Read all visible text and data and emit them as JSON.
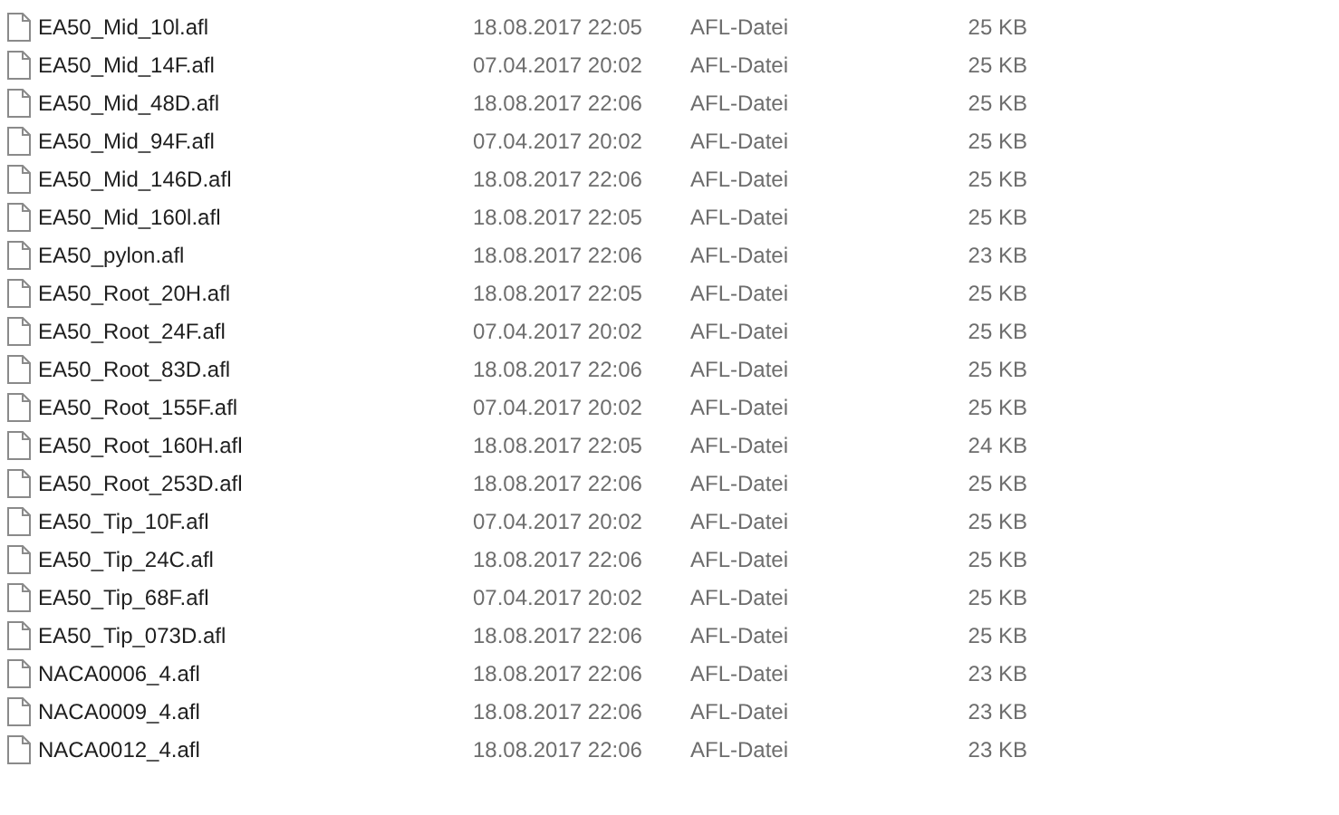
{
  "files": [
    {
      "name": "EA50_Mid_10l.afl",
      "date": "18.08.2017 22:05",
      "type": "AFL-Datei",
      "size": "25 KB"
    },
    {
      "name": "EA50_Mid_14F.afl",
      "date": "07.04.2017 20:02",
      "type": "AFL-Datei",
      "size": "25 KB"
    },
    {
      "name": "EA50_Mid_48D.afl",
      "date": "18.08.2017 22:06",
      "type": "AFL-Datei",
      "size": "25 KB"
    },
    {
      "name": "EA50_Mid_94F.afl",
      "date": "07.04.2017 20:02",
      "type": "AFL-Datei",
      "size": "25 KB"
    },
    {
      "name": "EA50_Mid_146D.afl",
      "date": "18.08.2017 22:06",
      "type": "AFL-Datei",
      "size": "25 KB"
    },
    {
      "name": "EA50_Mid_160l.afl",
      "date": "18.08.2017 22:05",
      "type": "AFL-Datei",
      "size": "25 KB"
    },
    {
      "name": "EA50_pylon.afl",
      "date": "18.08.2017 22:06",
      "type": "AFL-Datei",
      "size": "23 KB"
    },
    {
      "name": "EA50_Root_20H.afl",
      "date": "18.08.2017 22:05",
      "type": "AFL-Datei",
      "size": "25 KB"
    },
    {
      "name": "EA50_Root_24F.afl",
      "date": "07.04.2017 20:02",
      "type": "AFL-Datei",
      "size": "25 KB"
    },
    {
      "name": "EA50_Root_83D.afl",
      "date": "18.08.2017 22:06",
      "type": "AFL-Datei",
      "size": "25 KB"
    },
    {
      "name": "EA50_Root_155F.afl",
      "date": "07.04.2017 20:02",
      "type": "AFL-Datei",
      "size": "25 KB"
    },
    {
      "name": "EA50_Root_160H.afl",
      "date": "18.08.2017 22:05",
      "type": "AFL-Datei",
      "size": "24 KB"
    },
    {
      "name": "EA50_Root_253D.afl",
      "date": "18.08.2017 22:06",
      "type": "AFL-Datei",
      "size": "25 KB"
    },
    {
      "name": "EA50_Tip_10F.afl",
      "date": "07.04.2017 20:02",
      "type": "AFL-Datei",
      "size": "25 KB"
    },
    {
      "name": "EA50_Tip_24C.afl",
      "date": "18.08.2017 22:06",
      "type": "AFL-Datei",
      "size": "25 KB"
    },
    {
      "name": "EA50_Tip_68F.afl",
      "date": "07.04.2017 20:02",
      "type": "AFL-Datei",
      "size": "25 KB"
    },
    {
      "name": "EA50_Tip_073D.afl",
      "date": "18.08.2017 22:06",
      "type": "AFL-Datei",
      "size": "25 KB"
    },
    {
      "name": "NACA0006_4.afl",
      "date": "18.08.2017 22:06",
      "type": "AFL-Datei",
      "size": "23 KB"
    },
    {
      "name": "NACA0009_4.afl",
      "date": "18.08.2017 22:06",
      "type": "AFL-Datei",
      "size": "23 KB"
    },
    {
      "name": "NACA0012_4.afl",
      "date": "18.08.2017 22:06",
      "type": "AFL-Datei",
      "size": "23 KB"
    }
  ]
}
